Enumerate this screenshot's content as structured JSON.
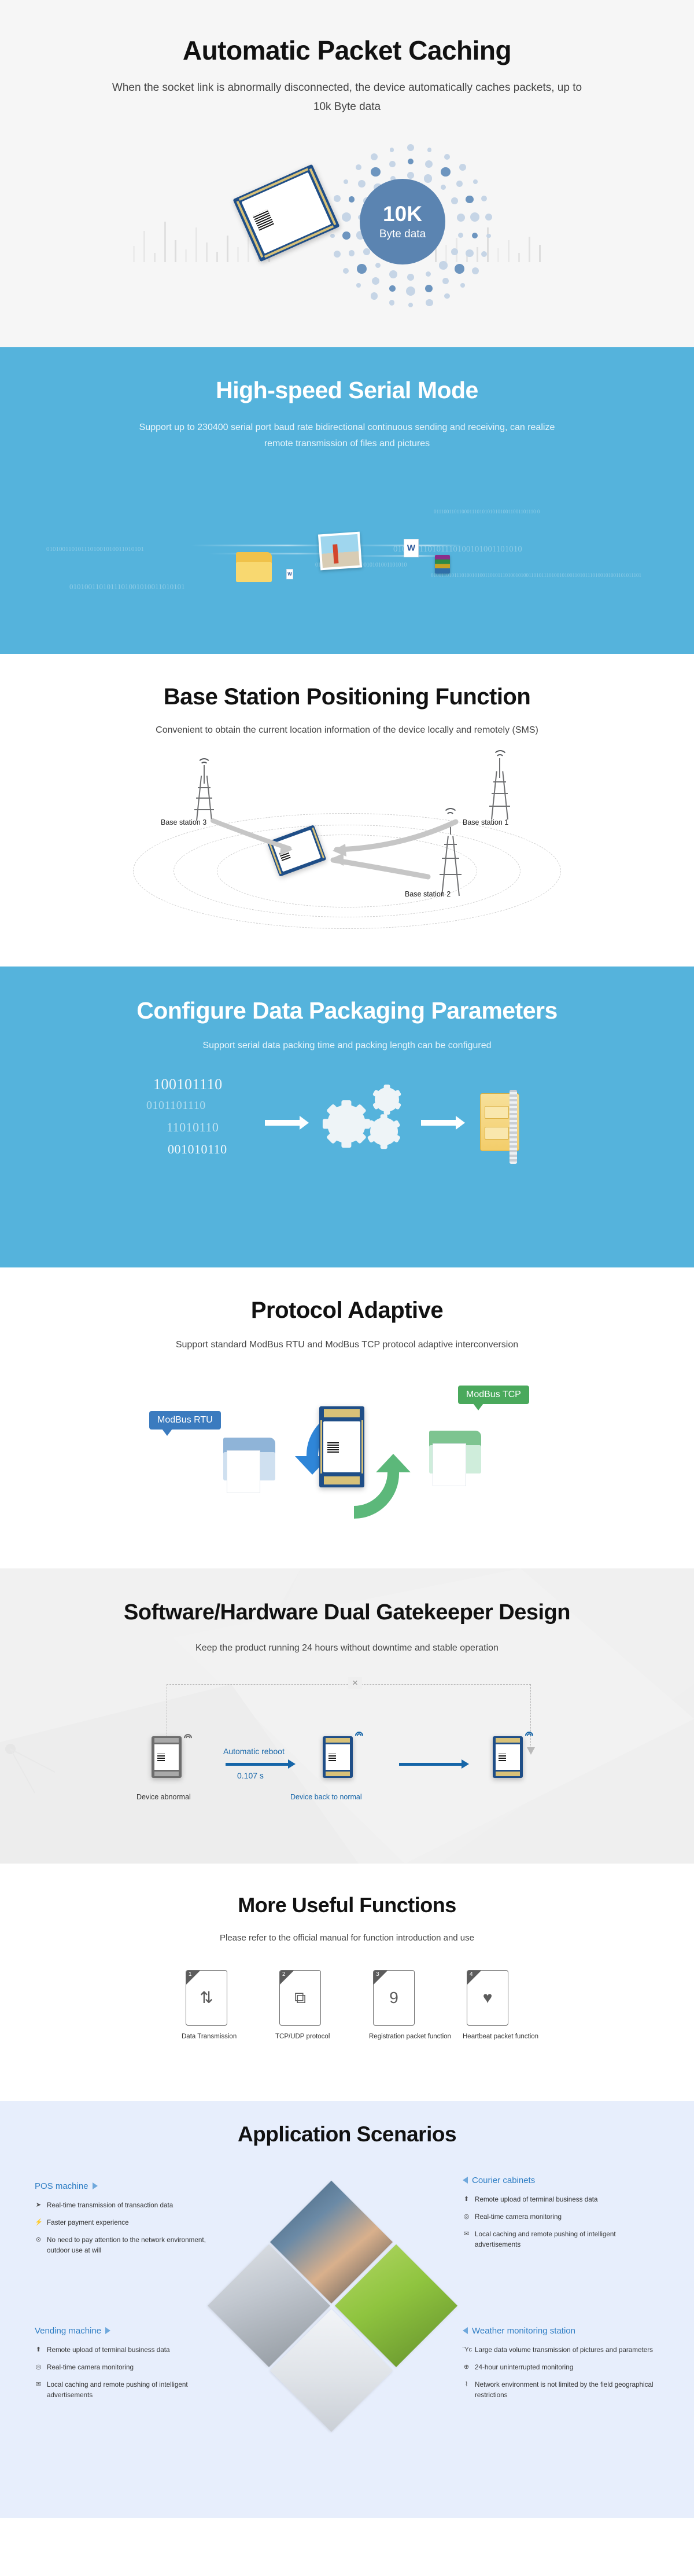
{
  "colors": {
    "blue_section_bg": "#55b3dc",
    "gray_section_bg": "#f6f6f6",
    "gatekeeper_bg": "#efefef",
    "scenario_bg": "#e7eefc",
    "accent_blue": "#2f7ec4",
    "deep_blue": "#1565a8",
    "badge_blue": "#5b84b1",
    "rtu_bubble": "#3b7bbf",
    "tcp_bubble": "#4aa95c",
    "marker_red": "#e2231a"
  },
  "caching": {
    "title": "Automatic Packet Caching",
    "subtitle": "When the socket link is abnormally disconnected, the device automatically caches packets, up to 10k Byte data",
    "badge_value": "10K",
    "badge_unit": "Byte data"
  },
  "serial": {
    "title": "High-speed Serial Mode",
    "subtitle": "Support up to 230400 serial port baud rate bidirectional continuous sending and receiving, can realize remote transmission of files and pictures",
    "binary_decor": [
      "0101001101011101001010011010101",
      "0111001101100011101010101010011001101110 0",
      "010100110101110100101001101010",
      "0100110101110100101001101011101001010011010111010010100110101110100101001101011101",
      "01010011010111010010101001101010",
      "0101001101011101001010011010101"
    ]
  },
  "base_station": {
    "title": "Base Station Positioning Function",
    "subtitle": "Convenient to obtain the current location information of the device locally and remotely (SMS)",
    "labels": [
      "Base station 1",
      "Base station 2",
      "Base station 3"
    ]
  },
  "packaging": {
    "title": "Configure Data Packaging Parameters",
    "subtitle": "Support serial data packing time and packing length can be configured",
    "binary_lines": [
      "100101110",
      "0101101110",
      "11010110",
      "001010110"
    ]
  },
  "protocol": {
    "title": "Protocol Adaptive",
    "subtitle": "Support standard ModBus RTU and ModBus TCP protocol adaptive interconversion",
    "bubble_left": "ModBus RTU",
    "bubble_right": "ModBus TCP"
  },
  "gatekeeper": {
    "title": "Software/Hardware Dual Gatekeeper Design",
    "subtitle": "Keep the product running 24 hours without downtime and stable operation",
    "label_abnormal": "Device abnormal",
    "label_reboot": "Automatic reboot",
    "label_time": "0.107 s",
    "label_normal": "Device back to normal",
    "fail_mark": "×"
  },
  "more_functions": {
    "title": "More Useful Functions",
    "subtitle": "Please refer to the official manual for function introduction and use",
    "cards": [
      {
        "num": "1",
        "glyph": "⇅",
        "label": "Data Transmission"
      },
      {
        "num": "2",
        "glyph": "⧉",
        "label": "TCP/UDP protocol"
      },
      {
        "num": "3",
        "glyph": "὜9",
        "label": "Registration packet function"
      },
      {
        "num": "4",
        "glyph": "♥",
        "label": "Heartbeat packet function"
      }
    ]
  },
  "scenarios": {
    "title": "Application Scenarios",
    "blocks": [
      {
        "name": "POS machine",
        "side": "left",
        "items": [
          {
            "icon": "➤",
            "text": "Real-time transmission of transaction data"
          },
          {
            "icon": "⚡",
            "text": "Faster payment experience"
          },
          {
            "icon": "⊙",
            "text": "No need to pay attention to the network environment, outdoor use at will"
          }
        ]
      },
      {
        "name": "Courier cabinets",
        "side": "right",
        "items": [
          {
            "icon": "⬆",
            "text": "Remote upload of terminal business data"
          },
          {
            "icon": "◎",
            "text": "Real-time camera monitoring"
          },
          {
            "icon": "✉",
            "text": "Local caching and remote pushing of intelligent advertisements"
          }
        ]
      },
      {
        "name": "Vending machine",
        "side": "left",
        "items": [
          {
            "icon": "⬆",
            "text": "Remote upload of terminal business data"
          },
          {
            "icon": "◎",
            "text": "Real-time camera monitoring"
          },
          {
            "icon": "✉",
            "text": "Local caching and remote pushing of intelligent advertisements"
          }
        ]
      },
      {
        "name": "Weather monitoring station",
        "side": "right",
        "items": [
          {
            "icon": "Ὓc",
            "text": "Large data volume transmission of pictures and parameters"
          },
          {
            "icon": "⊕",
            "text": "24-hour uninterrupted monitoring"
          },
          {
            "icon": "⌇",
            "text": "Network environment is not limited by the field geographical restrictions"
          }
        ]
      }
    ]
  }
}
